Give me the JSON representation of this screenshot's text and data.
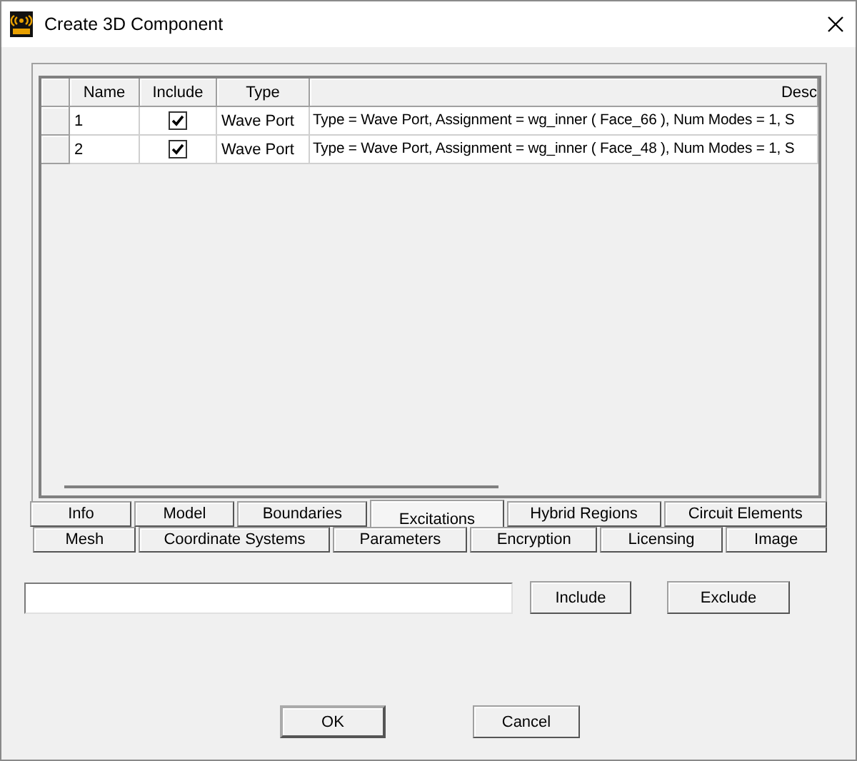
{
  "window": {
    "title": "Create 3D Component"
  },
  "table": {
    "columns": [
      "Name",
      "Include",
      "Type",
      "Desc"
    ],
    "rows": [
      {
        "name": "1",
        "include": true,
        "type": "Wave Port",
        "description": "Type = Wave Port, Assignment = wg_inner ( Face_66 ), Num Modes = 1, S"
      },
      {
        "name": "2",
        "include": true,
        "type": "Wave Port",
        "description": "Type = Wave Port, Assignment = wg_inner ( Face_48 ), Num Modes = 1, S"
      }
    ]
  },
  "tab_rows": [
    [
      {
        "label": "Info",
        "selected": false
      },
      {
        "label": "Model",
        "selected": false
      },
      {
        "label": "Boundaries",
        "selected": false
      },
      {
        "label": "Excitations",
        "selected": true
      },
      {
        "label": "Hybrid Regions",
        "selected": false
      },
      {
        "label": "Circuit Elements",
        "selected": false
      }
    ],
    [
      {
        "label": "Mesh",
        "selected": false
      },
      {
        "label": "Coordinate Systems",
        "selected": false
      },
      {
        "label": "Parameters",
        "selected": false
      },
      {
        "label": "Encryption",
        "selected": false
      },
      {
        "label": "Licensing",
        "selected": false
      },
      {
        "label": "Image",
        "selected": false
      }
    ]
  ],
  "filter": {
    "buttons": [
      "Include",
      "Exclude"
    ]
  },
  "buttons": [
    "OK",
    "Cancel"
  ]
}
